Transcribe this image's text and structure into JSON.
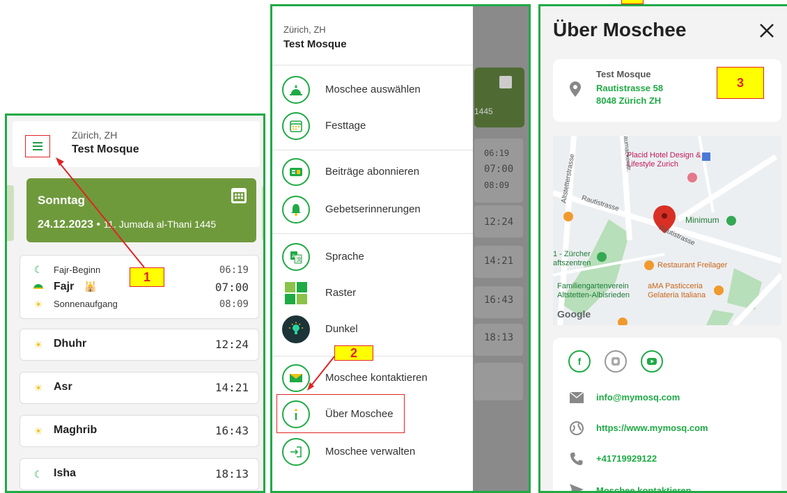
{
  "panel1": {
    "city": "Zürich, ZH",
    "mosque": "Test Mosque",
    "day_name": "Sonntag",
    "date_greg": "24.12.2023",
    "date_sep": "•",
    "date_hijri": "11. Jumada al-Thani 1445",
    "fajr_begin_label": "Fajr-Beginn",
    "fajr_begin_time": "06:19",
    "fajr_label": "Fajr",
    "fajr_time": "07:00",
    "sunrise_label": "Sonnenaufgang",
    "sunrise_time": "08:09",
    "prayers": [
      {
        "name": "Dhuhr",
        "time": "12:24"
      },
      {
        "name": "Asr",
        "time": "14:21"
      },
      {
        "name": "Maghrib",
        "time": "16:43"
      },
      {
        "name": "Isha",
        "time": "18:13"
      }
    ]
  },
  "callouts": {
    "one": "1",
    "two": "2",
    "three": "3"
  },
  "panel2": {
    "city": "Zürich, ZH",
    "mosque": "Test Mosque",
    "menu": [
      {
        "label": "Moschee auswählen",
        "icon": "mosque-icon"
      },
      {
        "label": "Festtage",
        "icon": "calendar-icon"
      },
      {
        "label": "Beiträge abonnieren",
        "icon": "newsletter-icon"
      },
      {
        "label": "Gebetserinnerungen",
        "icon": "bell-icon"
      },
      {
        "label": "Sprache",
        "icon": "translate-icon"
      },
      {
        "label": "Raster",
        "icon": "grid-icon"
      },
      {
        "label": "Dunkel",
        "icon": "lightbulb-icon"
      },
      {
        "label": "Moschee kontaktieren",
        "icon": "envelope-icon"
      },
      {
        "label": "Über Moschee",
        "icon": "info-icon"
      },
      {
        "label": "Moschee verwalten",
        "icon": "login-icon"
      }
    ],
    "bg_hijri": "1445",
    "bg_times": [
      "06:19",
      "07:00",
      "08:09",
      "12:24",
      "14:21",
      "16:43",
      "18:13"
    ]
  },
  "panel3": {
    "title": "Über Moschee",
    "mosque": "Test Mosque",
    "street": "Rautistrasse 58",
    "city": "8048 Zürich ZH",
    "map_labels": {
      "hotel": "Placid Hotel Design & Lifestyle Zurich",
      "minimum": "Minimum",
      "zurcher": "1 - Zürcher aftszentren",
      "freilager": "Restaurant Freilager",
      "verein": "Familiengartenverein Altstetten-Albisrieden",
      "pasticceria": "aMA Pasticceria Gelateria Italiana",
      "google": "Google",
      "rautistrasse1": "Rautistrasse",
      "rautistrasse2": "Rautistrasse",
      "altstetter": "Altstetterstrasse",
      "saumacker": "Saumackerstr."
    },
    "email": "info@mymosq.com",
    "website": "https://www.mymosq.com",
    "phone": "+41719929122",
    "contact": "Moschee kontaktieren"
  },
  "colors": {
    "green": "#1faa45",
    "card_green": "#6f9a3c",
    "callout_yellow": "#ffff00",
    "callout_red": "#e02424"
  }
}
